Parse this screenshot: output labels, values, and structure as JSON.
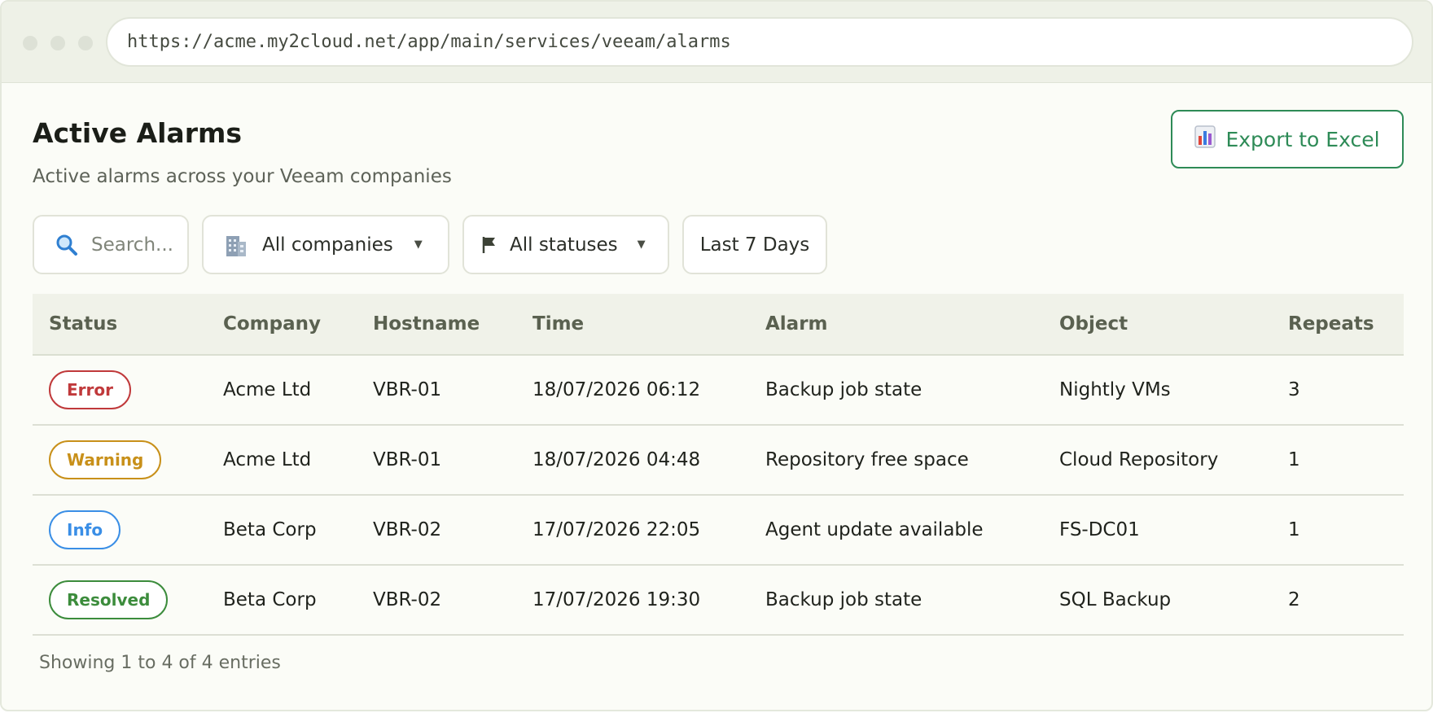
{
  "browser": {
    "url": "https://acme.my2cloud.net/app/main/services/veeam/alarms"
  },
  "header": {
    "title": "Active Alarms",
    "subtitle": "Active alarms across your Veeam companies",
    "export_label": "Export to Excel",
    "export_icon": "bar-chart-icon"
  },
  "filters": {
    "search_placeholder": "Search...",
    "company": "All companies",
    "status": "All statuses",
    "date_range": "Last 7 Days"
  },
  "table": {
    "columns": [
      "Status",
      "Company",
      "Hostname",
      "Time",
      "Alarm",
      "Object",
      "Repeats"
    ],
    "rows": [
      {
        "status": "Error",
        "company": "Acme Ltd",
        "hostname": "VBR-01",
        "time": "18/07/2026 06:12",
        "alarm": "Backup job state",
        "object": "Nightly VMs",
        "repeats": "3"
      },
      {
        "status": "Warning",
        "company": "Acme Ltd",
        "hostname": "VBR-01",
        "time": "18/07/2026 04:48",
        "alarm": "Repository free space",
        "object": "Cloud Repository",
        "repeats": "1"
      },
      {
        "status": "Info",
        "company": "Beta Corp",
        "hostname": "VBR-02",
        "time": "17/07/2026 22:05",
        "alarm": "Agent update available",
        "object": "FS-DC01",
        "repeats": "1"
      },
      {
        "status": "Resolved",
        "company": "Beta Corp",
        "hostname": "VBR-02",
        "time": "17/07/2026 19:30",
        "alarm": "Backup job state",
        "object": "SQL Backup",
        "repeats": "2"
      }
    ]
  },
  "status_colors": {
    "Error": "#c0393b",
    "Warning": "#c8901a",
    "Info": "#3a8ee6",
    "Resolved": "#3c8c3c"
  },
  "accent_color": "#2e8b57",
  "footer": {
    "entries_text": "Showing 1 to 4 of 4 entries"
  }
}
